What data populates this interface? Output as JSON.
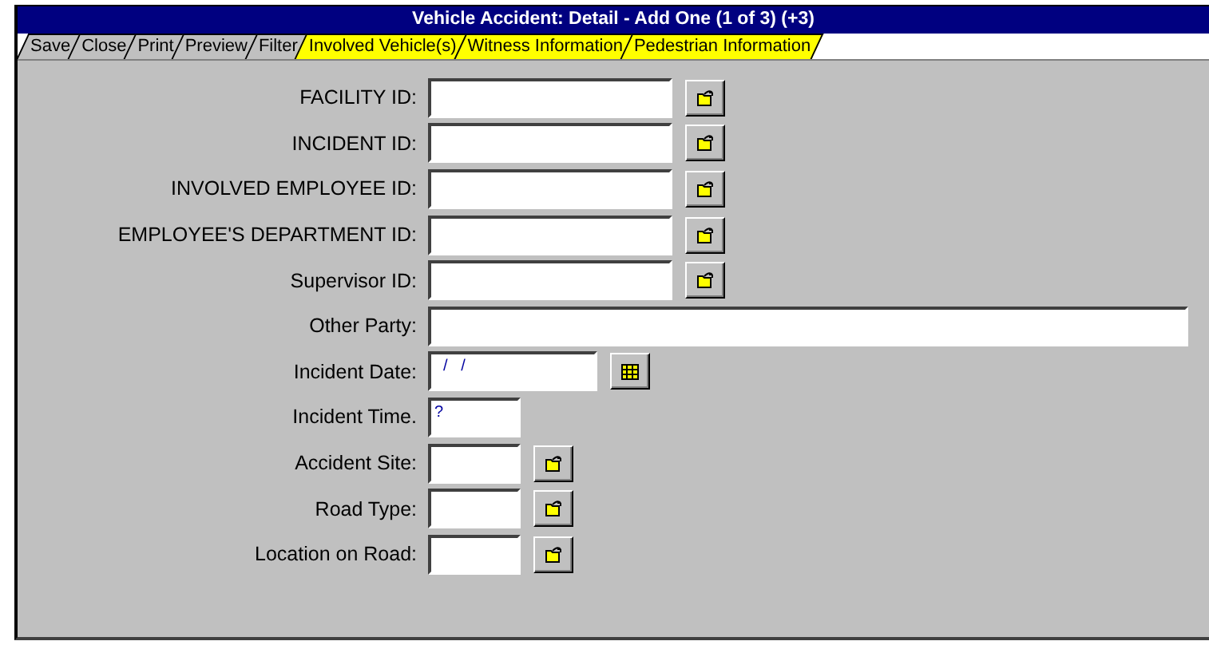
{
  "window": {
    "title": "Vehicle Accident: Detail - Add One (1 of 3) (+3)"
  },
  "tabs": [
    {
      "label": "Save",
      "kind": "action"
    },
    {
      "label": "Close",
      "kind": "action"
    },
    {
      "label": "Print",
      "kind": "action"
    },
    {
      "label": "Preview",
      "kind": "action"
    },
    {
      "label": "Filter",
      "kind": "action"
    },
    {
      "label": "Involved Vehicle(s)",
      "kind": "section"
    },
    {
      "label": "Witness Information",
      "kind": "section"
    },
    {
      "label": "Pedestrian Information",
      "kind": "section"
    }
  ],
  "fields": [
    {
      "label": "FACILITY ID:",
      "kind": "lookup"
    },
    {
      "label": "INCIDENT ID:",
      "kind": "lookup"
    },
    {
      "label": "INVOLVED EMPLOYEE ID:",
      "kind": "lookup"
    },
    {
      "label": "EMPLOYEE'S DEPARTMENT ID:",
      "kind": "lookup"
    },
    {
      "label": "Supervisor ID:",
      "kind": "lookup"
    },
    {
      "label": "Other Party:",
      "kind": "text"
    },
    {
      "label": "Incident Date:",
      "kind": "date",
      "value": "  /   /"
    },
    {
      "label": "Incident Time.",
      "kind": "text",
      "value": "?"
    },
    {
      "label": "Accident Site:",
      "kind": "lookup"
    },
    {
      "label": "Road Type:",
      "kind": "lookup"
    },
    {
      "label": "Location on Road:",
      "kind": "lookup"
    }
  ]
}
